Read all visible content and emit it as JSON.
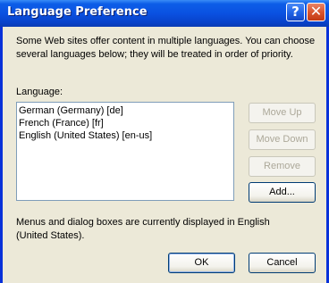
{
  "window": {
    "title": "Language Preference",
    "help_glyph": "?",
    "close_glyph": "✕"
  },
  "intro_text": "Some Web sites offer content in multiple languages. You can choose several languages below; they will be treated in order of priority.",
  "language_label": "Language:",
  "languages": [
    "German (Germany) [de]",
    "French (France) [fr]",
    "English (United States) [en-us]"
  ],
  "buttons": {
    "move_up": "Move Up",
    "move_down": "Move Down",
    "remove": "Remove",
    "add": "Add...",
    "ok": "OK",
    "cancel": "Cancel"
  },
  "footer_text": "Menus and dialog boxes are currently displayed in English (United States).",
  "icons": {
    "help": "help-icon",
    "close": "close-icon"
  },
  "colors": {
    "titlebar": "#0a51e1",
    "dialog_bg": "#ece9d8",
    "close_button": "#d9552e"
  }
}
